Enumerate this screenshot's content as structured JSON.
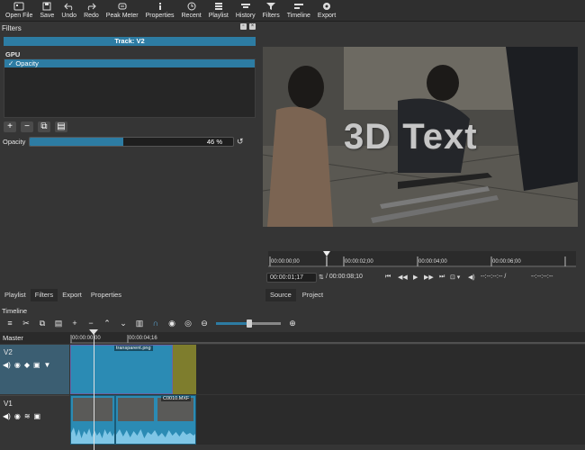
{
  "toolbar": [
    {
      "label": "Open File",
      "icon": "open-file-icon"
    },
    {
      "label": "Save",
      "icon": "save-icon"
    },
    {
      "label": "Undo",
      "icon": "undo-icon"
    },
    {
      "label": "Redo",
      "icon": "redo-icon"
    },
    {
      "label": "Peak Meter",
      "icon": "peak-meter-icon"
    },
    {
      "label": "Properties",
      "icon": "info-icon"
    },
    {
      "label": "Recent",
      "icon": "clock-icon"
    },
    {
      "label": "Playlist",
      "icon": "playlist-icon"
    },
    {
      "label": "History",
      "icon": "history-icon"
    },
    {
      "label": "Filters",
      "icon": "filter-icon"
    },
    {
      "label": "Timeline",
      "icon": "timeline-icon"
    },
    {
      "label": "Export",
      "icon": "export-icon"
    }
  ],
  "filters": {
    "title": "Filters",
    "track": "Track: V2",
    "group": "GPU",
    "items": [
      "Opacity"
    ],
    "opacity_label": "Opacity",
    "opacity_value": "46 %",
    "opacity_fraction": 0.46
  },
  "player": {
    "overlay_text": "3D Text",
    "ruler_ticks": [
      "00:00:00;00",
      "00:00:02;00",
      "00:00:04;00",
      "00:00:06;00"
    ],
    "position": "00:00:01;17",
    "duration": "/ 00:00:08;10",
    "in_point": "--:--:--:-- /",
    "out_point": "--:--:--:--"
  },
  "left_tabs": [
    "Playlist",
    "Filters",
    "Export",
    "Properties"
  ],
  "right_tabs": [
    "Source",
    "Project"
  ],
  "timeline": {
    "title": "Timeline",
    "master": "Master",
    "ruler_ticks": [
      "00:00:00;00",
      "00:00:04;16"
    ],
    "tracks": [
      {
        "name": "V2",
        "clip": "transparent.png"
      },
      {
        "name": "V1",
        "clip": "C0010.MXF"
      }
    ]
  }
}
